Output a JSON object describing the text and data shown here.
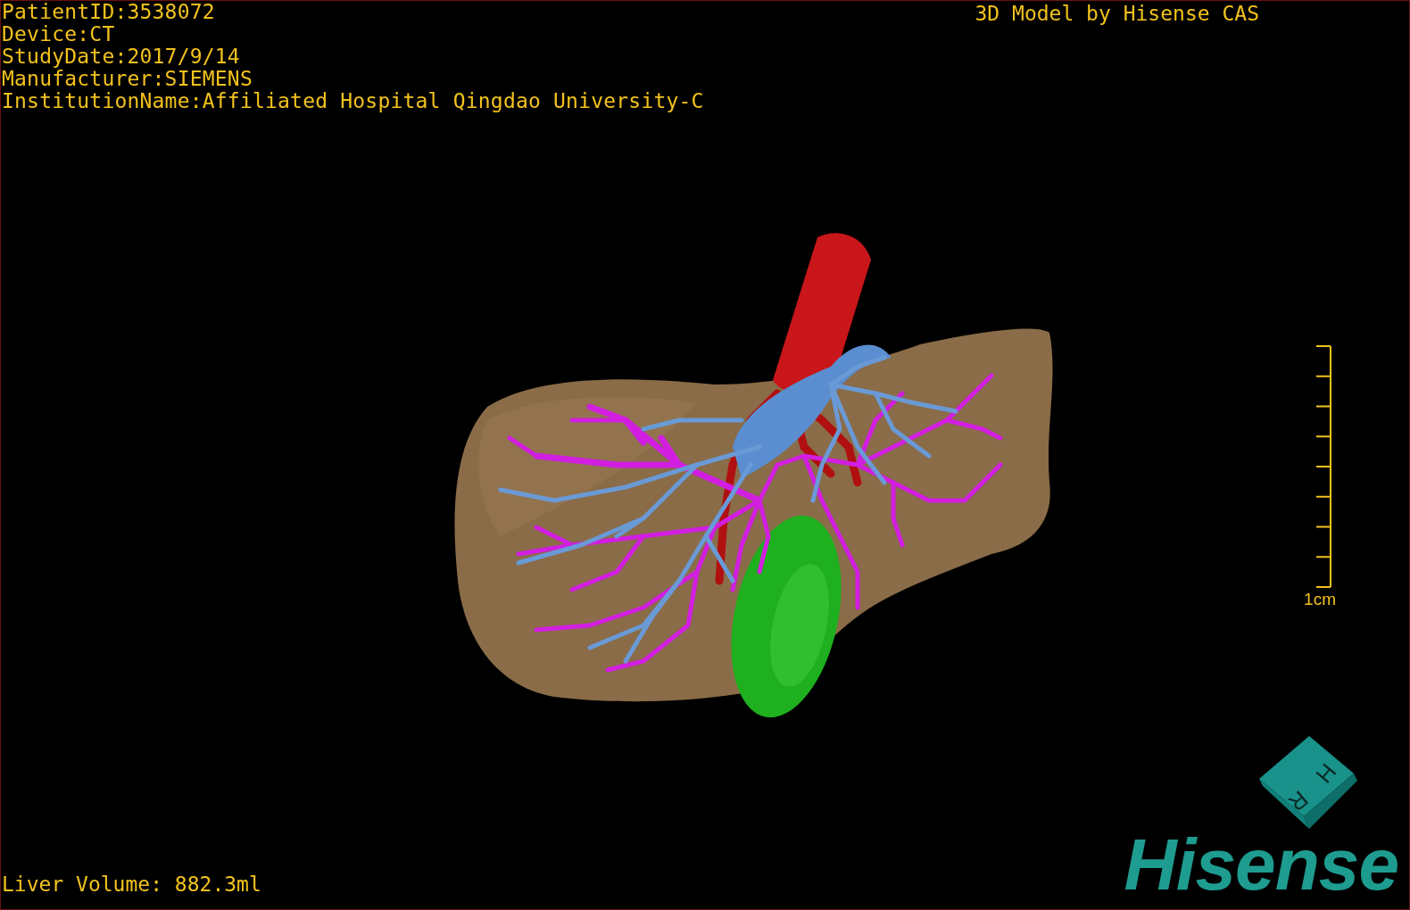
{
  "info_lines": [
    "PatientID:3538072",
    "Device:CT",
    "StudyDate:2017/9/14",
    "Manufacturer:SIEMENS",
    "InstitutionName:Affiliated Hospital Qingdao University-C"
  ],
  "credit": "3D Model by Hisense CAS",
  "scale_bar": {
    "label": "1cm"
  },
  "volume": "Liver Volume: 882.3ml",
  "orientation_cube": {
    "labels": [
      "H",
      "R"
    ]
  },
  "logo": "Hisense"
}
